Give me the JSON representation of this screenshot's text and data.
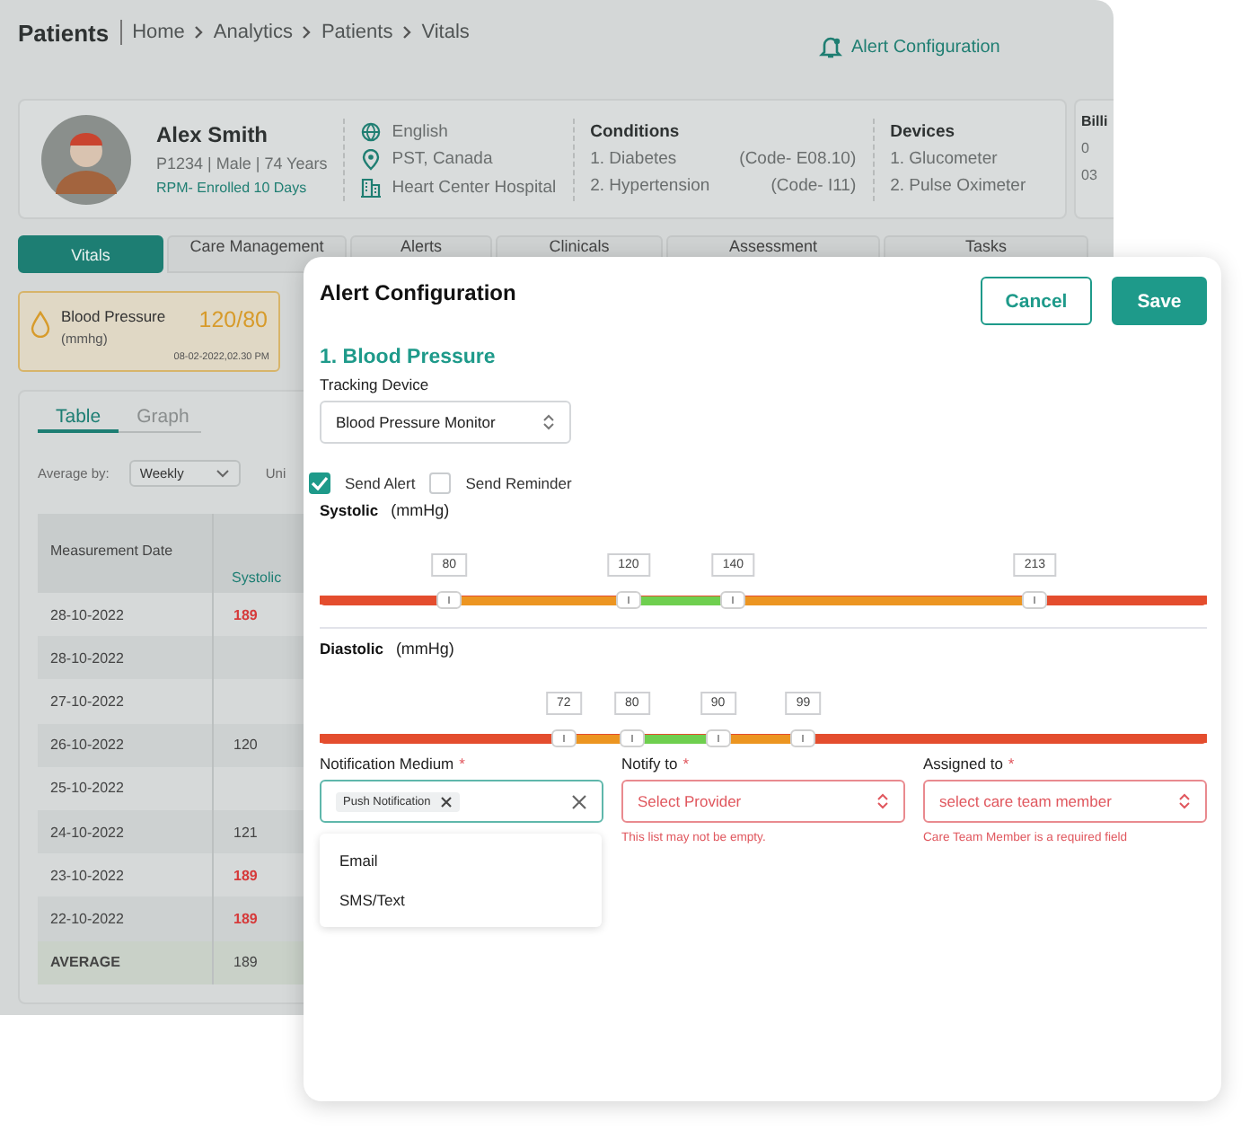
{
  "header": {
    "title": "Patients",
    "breadcrumb": [
      "Home",
      "Analytics",
      "Patients",
      "Vitals"
    ],
    "alert_link": "Alert Configuration"
  },
  "patient": {
    "name": "Alex Smith",
    "details": "P1234 | Male | 74 Years",
    "enrollment": "RPM- Enrolled 10 Days",
    "info": [
      {
        "kind": "globe",
        "text": "English"
      },
      {
        "kind": "pin",
        "text": "PST, Canada"
      },
      {
        "kind": "building",
        "text": "Heart Center Hospital"
      }
    ],
    "conditions": {
      "title": "Conditions",
      "items": [
        {
          "name": "1. Diabetes",
          "code": "(Code- E08.10)"
        },
        {
          "name": "2. Hypertension",
          "code": "(Code- I11)"
        }
      ]
    },
    "devices": {
      "title": "Devices",
      "items": [
        "1. Glucometer",
        "2. Pulse Oximeter"
      ]
    }
  },
  "billing": {
    "title": "Billi",
    "lines": [
      "0",
      "03"
    ]
  },
  "tabs": [
    {
      "label": "Vitals",
      "selected": true
    },
    {
      "label": "Care Management",
      "selected": false
    },
    {
      "label": "Alerts",
      "selected": false
    },
    {
      "label": "Clinicals",
      "selected": false
    },
    {
      "label": "Assessment",
      "selected": false
    },
    {
      "label": "Tasks",
      "selected": false
    }
  ],
  "vital_card": {
    "name": "Blood Pressure",
    "unit": "(mmhg)",
    "value": "120/80",
    "time": "08-02-2022,02.30 PM"
  },
  "view_tabs": [
    {
      "label": "Table",
      "selected": true
    },
    {
      "label": "Graph",
      "selected": false
    }
  ],
  "average_by": {
    "label": "Average by:",
    "value": "Weekly"
  },
  "unit_label": "Uni",
  "table": {
    "columns": [
      "Measurement Date",
      "Systolic"
    ],
    "rows": [
      {
        "date": "28-10-2022",
        "systolic": "189",
        "alert": true
      },
      {
        "date": "28-10-2022"
      },
      {
        "date": "27-10-2022"
      },
      {
        "date": "26-10-2022",
        "systolic": "120",
        "alert": false
      },
      {
        "date": "25-10-2022"
      },
      {
        "date": "24-10-2022",
        "systolic": "121",
        "alert": false
      },
      {
        "date": "23-10-2022",
        "systolic": "189",
        "alert": true
      },
      {
        "date": "22-10-2022",
        "systolic": "189",
        "alert": true
      }
    ],
    "average": {
      "label": "AVERAGE",
      "systolic": "189"
    }
  },
  "modal": {
    "title": "Alert Configuration",
    "buttons": [
      {
        "label": "Cancel",
        "kind": "secondary"
      },
      {
        "label": "Save",
        "kind": "primary"
      }
    ],
    "section": "1. Blood Pressure",
    "device_label": "Tracking Device",
    "device": "Blood Pressure Monitor",
    "options": [
      {
        "label": "Send Alert",
        "checked": true
      },
      {
        "label": "Send Reminder",
        "checked": false
      }
    ],
    "sliders": [
      {
        "name": "Systolic",
        "unit": "(mmHg)",
        "thumbs": [
          {
            "value": "80",
            "level": 0.146
          },
          {
            "value": "120",
            "level": 0.348
          },
          {
            "value": "140",
            "level": 0.466
          },
          {
            "value": "213",
            "level": 0.806
          }
        ]
      },
      {
        "name": "Diastolic",
        "unit": "(mmHg)",
        "thumbs": [
          {
            "value": "72",
            "level": 0.275
          },
          {
            "value": "80",
            "level": 0.352
          },
          {
            "value": "90",
            "level": 0.449
          },
          {
            "value": "99",
            "level": 0.545
          }
        ]
      }
    ],
    "fields": [
      {
        "kind": "multiselect",
        "label": "Notification Medium",
        "required_mark": "*",
        "chips": [
          "Push Notification"
        ],
        "options": [
          "Email",
          "SMS/Text"
        ],
        "invalid": false
      },
      {
        "kind": "select",
        "label": "Notify to",
        "required_mark": "*",
        "placeholder": "Select Provider",
        "error": "This list may not be empty.",
        "invalid": true
      },
      {
        "kind": "select",
        "label": "Assigned to",
        "required_mark": "*",
        "placeholder": "select care team member",
        "error": "Care Team Member is a required field",
        "invalid": true
      }
    ]
  }
}
